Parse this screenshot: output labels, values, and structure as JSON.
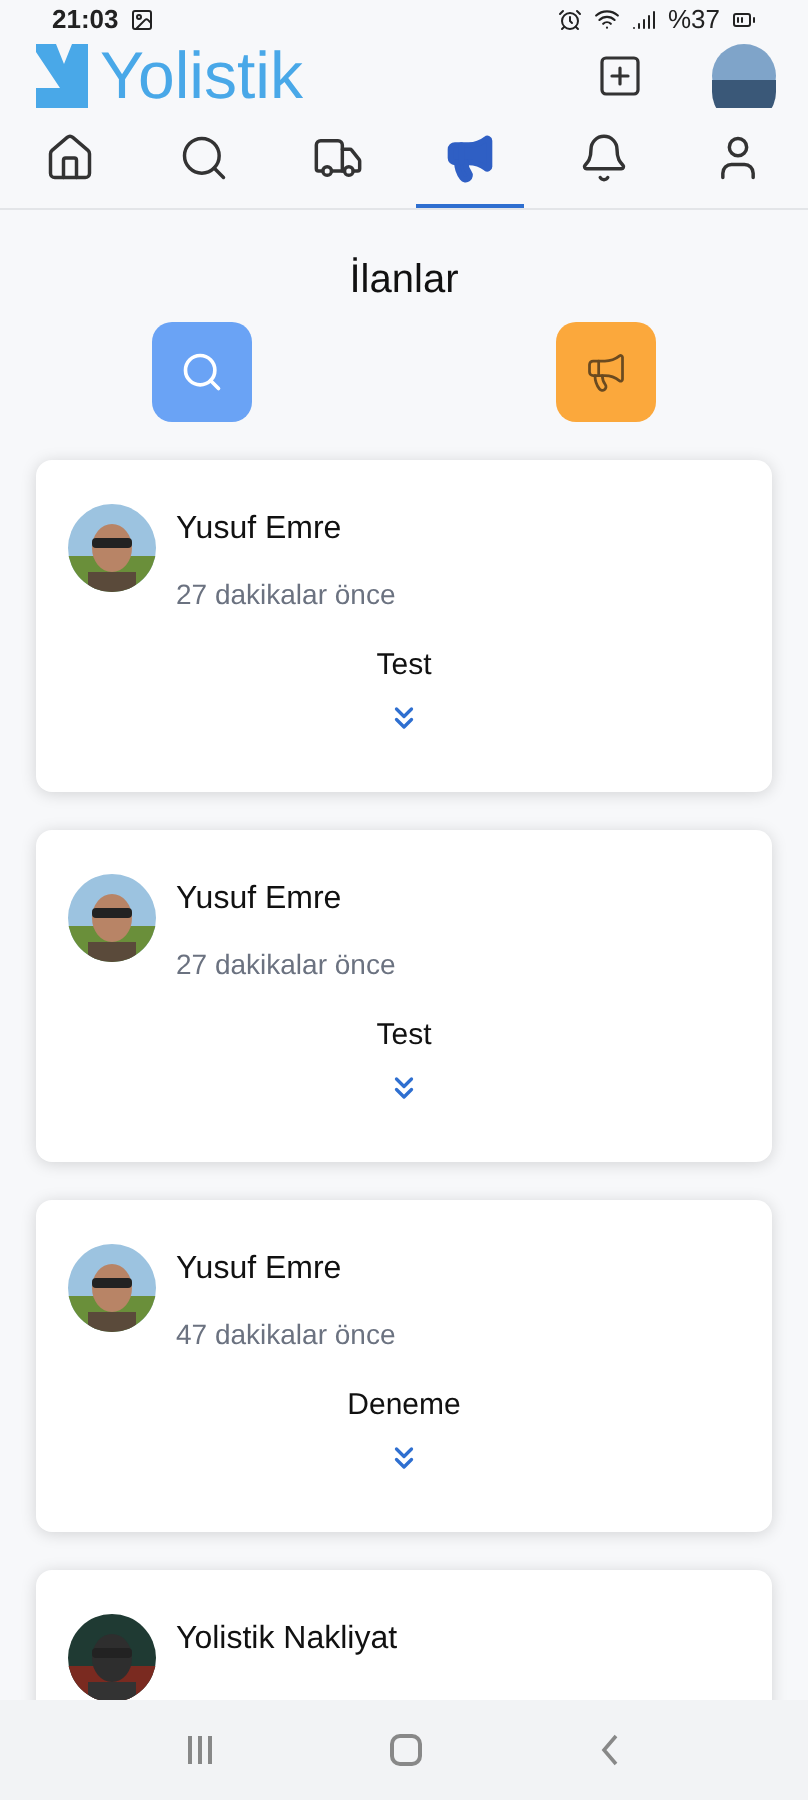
{
  "status_bar": {
    "time": "21:03",
    "battery": "%37"
  },
  "header": {
    "logo_text": "Yolistik"
  },
  "tabs": [
    {
      "kind": "home",
      "selected": false
    },
    {
      "kind": "search",
      "selected": false
    },
    {
      "kind": "truck",
      "selected": false
    },
    {
      "kind": "megaphone",
      "selected": true
    },
    {
      "kind": "bell",
      "selected": false
    },
    {
      "kind": "user",
      "selected": false
    }
  ],
  "page_title": "İlanlar",
  "posts": [
    {
      "author": "Yusuf Emre",
      "time": "27 dakikalar önce",
      "text": "Test"
    },
    {
      "author": "Yusuf Emre",
      "time": "27 dakikalar önce",
      "text": "Test"
    },
    {
      "author": "Yusuf Emre",
      "time": "47 dakikalar önce",
      "text": "Deneme"
    },
    {
      "author": "Yolistik Nakliyat"
    }
  ]
}
